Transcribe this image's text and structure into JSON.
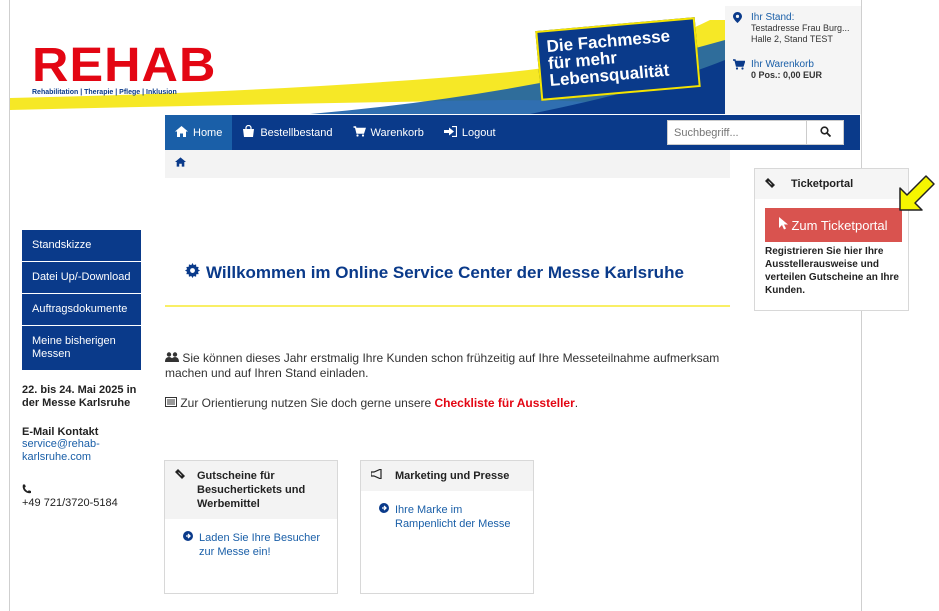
{
  "header": {
    "logo": "REHAB",
    "logo_sub": "Rehabilitation | Therapie | Pflege | Inklusion",
    "tagline": [
      "Die Fachmesse",
      "für mehr",
      "Lebensqualität"
    ],
    "stand": {
      "label": "Ihr Stand:",
      "line1": "Testadresse Frau Burg...",
      "line2": "Halle 2, Stand TEST"
    },
    "cart": {
      "label": "Ihr Warenkorb",
      "summary": "0 Pos.: 0,00 EUR"
    }
  },
  "nav": {
    "items": [
      {
        "label": "Home",
        "icon": "home-icon"
      },
      {
        "label": "Bestellbestand",
        "icon": "shopping-bag-icon"
      },
      {
        "label": "Warenkorb",
        "icon": "cart-icon"
      },
      {
        "label": "Logout",
        "icon": "logout-icon"
      }
    ],
    "search_placeholder": "Suchbegriff..."
  },
  "sidebar": {
    "items": [
      "Standskizze",
      "Datei Up/-Download",
      "Auftragsdokumente",
      "Meine bisherigen Messen"
    ],
    "date": "22. bis 24. Mai 2025 in der Messe Karlsruhe",
    "contact_heading": "E-Mail Kontakt",
    "email": "service@rehab-karlsruhe.com",
    "phone": "+49 721/3720-5184"
  },
  "main": {
    "welcome": "Willkommen im Online Service Center der Messe Karlsruhe",
    "para1": "Sie können dieses Jahr erstmalig Ihre Kunden schon frühzeitig auf Ihre Messeteilnahme aufmerksam machen und auf Ihren Stand einladen.",
    "para2_prefix": "Zur Orientierung nutzen Sie doch gerne unsere ",
    "para2_link": "Checkliste für Aussteller",
    "para2_suffix": ".",
    "cards": [
      {
        "title": "Gutscheine für Besuchertickets und Werbemittel",
        "link": "Laden Sie Ihre Besucher zur Messe ein!"
      },
      {
        "title": "Marketing und Presse",
        "link": "Ihre Marke im Rampenlicht der Messe"
      }
    ]
  },
  "ticketportal": {
    "title": "Ticketportal",
    "button": "Zum Ticketportal",
    "text": "Registrieren Sie hier Ihre Ausstellerausweise und verteilen Gutscheine an Ihre Kunden."
  },
  "colors": {
    "brand_blue": "#0a3a8a",
    "brand_red": "#e30613",
    "accent_yellow": "#f5e400",
    "button_red": "#d9534f"
  }
}
